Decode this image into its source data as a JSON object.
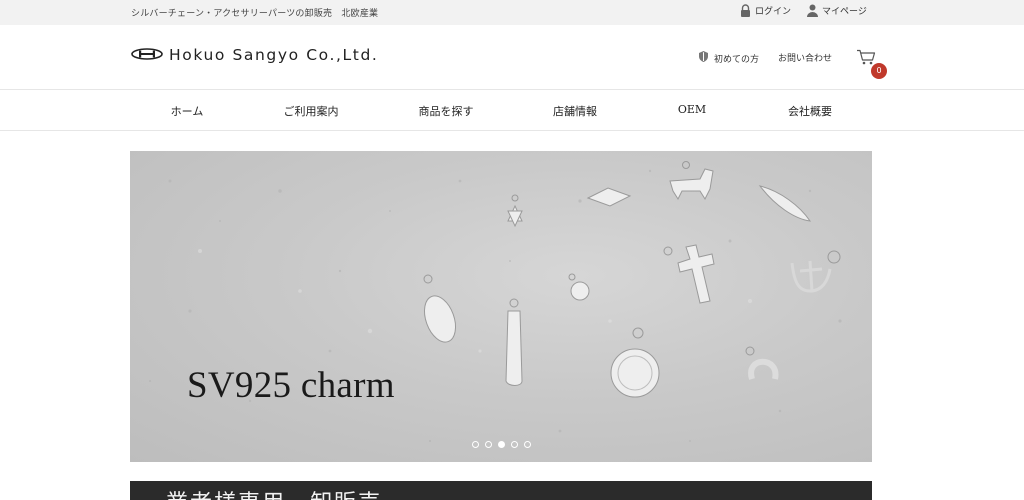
{
  "topbar": {
    "tagline": "シルバーチェーン・アクセサリーパーツの卸販売　北欧産業",
    "login_label": "ログイン",
    "mypage_label": "マイページ"
  },
  "header": {
    "logo_text": "Hokuo Sangyo Co.,Ltd.",
    "beginner_label": "初めての方",
    "contact_label": "お問い合わせ",
    "cart_count": "0"
  },
  "nav": {
    "items": [
      {
        "label": "ホーム"
      },
      {
        "label": "ご利用案内"
      },
      {
        "label": "商品を探す"
      },
      {
        "label": "店舗情報"
      },
      {
        "label": "OEM"
      },
      {
        "label": "会社概要"
      }
    ]
  },
  "hero": {
    "title": "SV925 charm",
    "slide_count": 5,
    "active_slide": 3
  },
  "banner": {
    "text": "業者様専用　卸販売"
  },
  "colors": {
    "topbar_bg": "#f2f2f2",
    "badge": "#c0392b",
    "banner_bg": "#2b2b2b"
  }
}
